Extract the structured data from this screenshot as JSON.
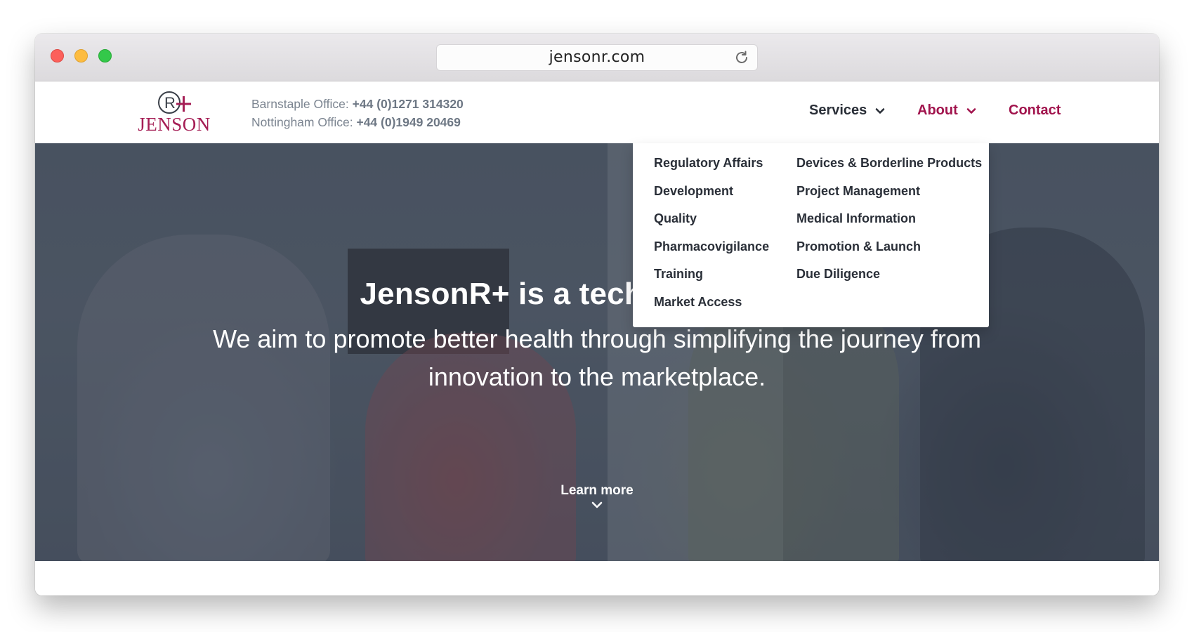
{
  "browser": {
    "url": "jensonr.com"
  },
  "header": {
    "logo": {
      "symbol": "R+",
      "name": "JENSON",
      "brand_color": "#a51e55"
    },
    "offices": [
      {
        "label": "Barnstaple Office:",
        "phone": "+44 (0)1271 314320"
      },
      {
        "label": "Nottingham Office:",
        "phone": "+44 (0)1949 20469"
      }
    ],
    "nav": {
      "services": "Services",
      "about": "About",
      "contact": "Contact"
    }
  },
  "dropdown": {
    "left_items": [
      "Regulatory Affairs",
      "Development",
      "Quality",
      "Pharmacovigilance",
      "Training",
      "Market Access"
    ],
    "right_items": [
      "Devices & Borderline Products",
      "Project Management",
      "Medical Information",
      "Promotion & Launch",
      "Due Diligence"
    ]
  },
  "hero": {
    "title_visible": "JensonR+ is a technical consult",
    "subtitle": "We aim to promote better health through simplifying the journey from innovation to the marketplace.",
    "cta": "Learn more"
  },
  "colors": {
    "accent": "#a1144d",
    "nav_text": "#2a2f38",
    "office_text": "#7b8490"
  },
  "icons": [
    "reload-icon",
    "chevron-down-icon"
  ]
}
